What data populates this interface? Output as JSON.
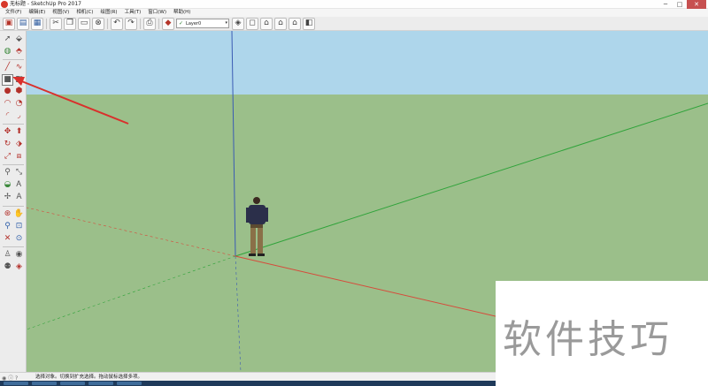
{
  "window": {
    "title": "无标题 - SketchUp Pro 2017",
    "minimize": "─",
    "maximize": "□",
    "close": "✕"
  },
  "menu": [
    "文件(F)",
    "编辑(E)",
    "视图(V)",
    "相机(C)",
    "绘图(R)",
    "工具(T)",
    "窗口(W)",
    "帮助(H)"
  ],
  "layer_selector": {
    "value": "Layer0"
  },
  "status": {
    "text": "选择对象。切换到扩充选择。拖动鼠标选择多项。"
  },
  "watermark": {
    "text": "软件技巧"
  },
  "colors": {
    "sky": "#aed6eb",
    "ground": "#9bbf8a",
    "axis_red": "#d64b3b",
    "axis_green": "#2fa33a",
    "axis_blue": "#3a5bb3",
    "annotation_arrow": "#d9302c"
  },
  "icons": {
    "toolbar": [
      "new-file-icon",
      "open-icon",
      "save-icon",
      "cut-icon",
      "copy-icon",
      "paste-icon",
      "erase-icon",
      "undo-icon",
      "redo-icon",
      "print-icon",
      "model-info-icon",
      "iso-view-icon",
      "top-view-icon",
      "front-view-icon",
      "right-view-icon",
      "back-view-icon",
      "left-view-icon"
    ],
    "left_tools": [
      "select-icon",
      "eraser-icon",
      "paint-bucket-icon",
      "make-component-icon",
      "line-icon",
      "freehand-icon",
      "rectangle-icon",
      "rotated-rectangle-icon",
      "circle-icon",
      "polygon-icon",
      "arc-icon",
      "pie-icon",
      "move-icon",
      "push-pull-icon",
      "rotate-icon",
      "follow-me-icon",
      "scale-icon",
      "offset-icon",
      "tape-measure-icon",
      "dimension-icon",
      "protractor-icon",
      "text-icon",
      "axes-icon",
      "3d-text-icon",
      "orbit-icon",
      "pan-icon",
      "zoom-icon",
      "zoom-window-icon",
      "zoom-extents-icon",
      "previous-icon",
      "position-camera-icon",
      "walk-icon",
      "look-around-icon",
      "section-plane-icon"
    ]
  }
}
